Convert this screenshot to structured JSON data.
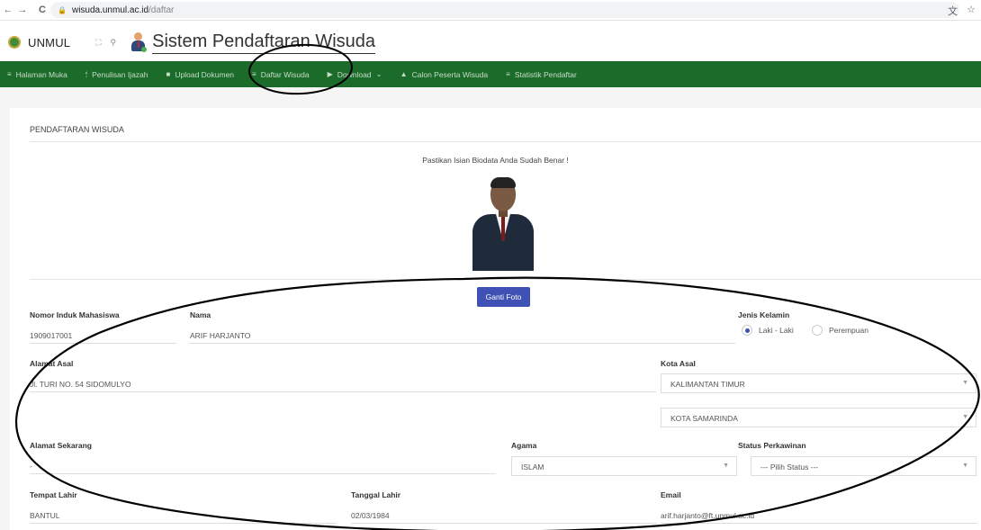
{
  "browser": {
    "back_icon": "←",
    "forward_icon": "→",
    "reload_icon": "C",
    "url_host": "wisuda.unmul.ac.id",
    "url_path": "/daftar",
    "translate_icon": "文",
    "star_icon": "☆"
  },
  "app": {
    "brand": "UNMUL",
    "title": "Sistem Pendaftaran Wisuda",
    "icons": {
      "fullscreen": "⛶",
      "search": "⚲"
    }
  },
  "nav": {
    "items": [
      {
        "icon": "≡",
        "label": "Halaman Muka"
      },
      {
        "icon": "🕯",
        "label": "Penulisan Ijazah"
      },
      {
        "icon": "■",
        "label": "Upload Dokumen"
      },
      {
        "icon": "≡",
        "label": "Daftar Wisuda"
      },
      {
        "icon": "▶",
        "label": "Download",
        "caret": "⌄"
      },
      {
        "icon": "▲",
        "label": "Calon Peserta Wisuda"
      },
      {
        "icon": "≡",
        "label": "Statistik Pendaftar"
      }
    ]
  },
  "form": {
    "heading": "PENDAFTARAN WISUDA",
    "notice": "Pastikan Isian Biodata Anda Sudah Benar !",
    "change_photo_label": "Ganti Foto",
    "nim": {
      "label": "Nomor Induk Mahasiswa",
      "value": "1909017001"
    },
    "nama": {
      "label": "Nama",
      "value": "ARIF HARJANTO"
    },
    "gender": {
      "label": "Jenis Kelamin",
      "options": [
        "Laki - Laki",
        "Perempuan"
      ],
      "selected": "Laki - Laki"
    },
    "alamat_asal": {
      "label": "Alamat Asal",
      "value": "Jl. TURI NO. 54 SIDOMULYO"
    },
    "kota_asal": {
      "label": "Kota Asal",
      "province": "KALIMANTAN TIMUR",
      "city": "KOTA SAMARINDA"
    },
    "alamat_sekarang": {
      "label": "Alamat Sekarang",
      "value": "-"
    },
    "agama": {
      "label": "Agama",
      "value": "ISLAM"
    },
    "status": {
      "label": "Status Perkawinan",
      "value": "--- Pilih Status ---"
    },
    "tempat_lahir": {
      "label": "Tempat Lahir",
      "value": "BANTUL"
    },
    "tanggal_lahir": {
      "label": "Tanggal Lahir",
      "value": "02/03/1984"
    },
    "email": {
      "label": "Email",
      "value": "arif.harjanto@ft.unmul.ac.id"
    }
  },
  "colors": {
    "nav_bg": "#1b6b2a",
    "button": "#3f51b5"
  }
}
